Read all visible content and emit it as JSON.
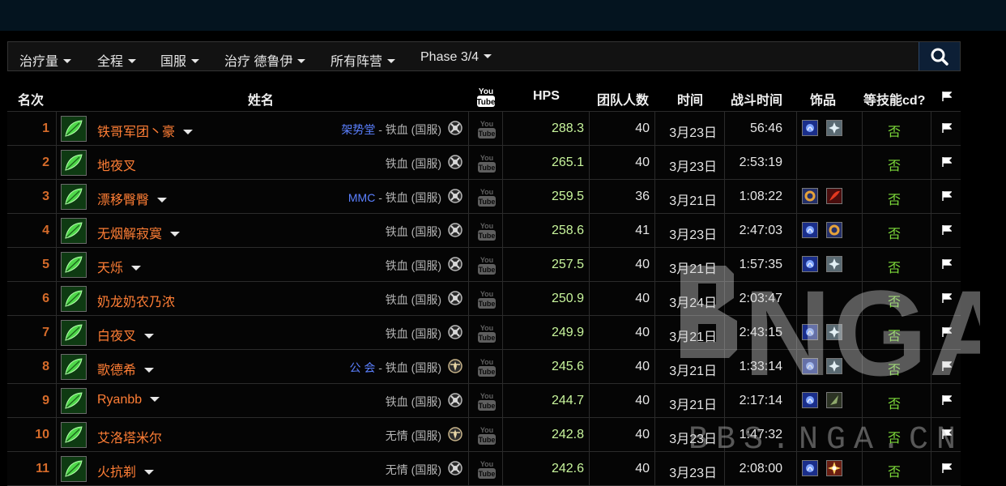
{
  "filters": [
    {
      "label": "治疗量"
    },
    {
      "label": "全程"
    },
    {
      "label": "国服"
    },
    {
      "label": "治疗 德鲁伊"
    },
    {
      "label": "所有阵营"
    },
    {
      "label": "Phase 3/4"
    }
  ],
  "columns": {
    "rank": "名次",
    "name": "姓名",
    "hps": "HPS",
    "raid_size": "团队人数",
    "date": "时间",
    "duration": "战斗时间",
    "trinkets": "饰品",
    "wait_cd": "等技能cd?"
  },
  "rows": [
    {
      "rank": "1",
      "name": "铁哥军团丶豪",
      "menu": true,
      "guild": "架势堂",
      "separator": " - ",
      "realm": "铁血 (国服)",
      "hps": "288.3",
      "raid": "40",
      "date": "3月23日",
      "dur": "56:46",
      "trinkets": [
        "blue-orb",
        "silver-star"
      ],
      "cd": "否",
      "faction": "horde"
    },
    {
      "rank": "2",
      "name": "地夜叉",
      "menu": false,
      "guild": "",
      "separator": "",
      "realm": "铁血 (国服)",
      "hps": "265.1",
      "raid": "40",
      "date": "3月23日",
      "dur": "2:53:19",
      "trinkets": [],
      "cd": "否",
      "faction": "horde"
    },
    {
      "rank": "3",
      "name": "漂移臀臀",
      "menu": true,
      "guild": "MMC",
      "separator": " - ",
      "realm": "铁血 (国服)",
      "hps": "259.5",
      "raid": "36",
      "date": "3月21日",
      "dur": "1:08:22",
      "trinkets": [
        "gold-ring",
        "red-feather"
      ],
      "cd": "否",
      "faction": "horde"
    },
    {
      "rank": "4",
      "name": "无烟解寂寞",
      "menu": true,
      "guild": "",
      "separator": "",
      "realm": "铁血 (国服)",
      "hps": "258.6",
      "raid": "41",
      "date": "3月23日",
      "dur": "2:47:03",
      "trinkets": [
        "blue-orb",
        "gold-ring"
      ],
      "cd": "否",
      "faction": "horde"
    },
    {
      "rank": "5",
      "name": "天烁",
      "menu": true,
      "guild": "",
      "separator": "",
      "realm": "铁血 (国服)",
      "hps": "257.5",
      "raid": "40",
      "date": "3月21日",
      "dur": "1:57:35",
      "trinkets": [
        "blue-orb",
        "silver-star"
      ],
      "cd": "否",
      "faction": "horde"
    },
    {
      "rank": "6",
      "name": "奶龙奶农乃浓",
      "menu": false,
      "guild": "",
      "separator": "",
      "realm": "铁血 (国服)",
      "hps": "250.9",
      "raid": "40",
      "date": "3月24日",
      "dur": "2:03:47",
      "trinkets": [],
      "cd": "否",
      "faction": "horde"
    },
    {
      "rank": "7",
      "name": "白夜叉",
      "menu": true,
      "guild": "",
      "separator": "",
      "realm": "铁血 (国服)",
      "hps": "249.9",
      "raid": "40",
      "date": "3月21日",
      "dur": "2:43:15",
      "trinkets": [
        "blue-orb",
        "silver-star"
      ],
      "cd": "否",
      "faction": "horde"
    },
    {
      "rank": "8",
      "name": "歌德希",
      "menu": true,
      "guild": "公 会",
      "separator": " - ",
      "realm": "铁血 (国服)",
      "hps": "245.6",
      "raid": "40",
      "date": "3月21日",
      "dur": "1:33:14",
      "trinkets": [
        "blue-orb",
        "silver-star"
      ],
      "cd": "否",
      "faction": "alliance"
    },
    {
      "rank": "9",
      "name": "Ryanbb",
      "menu": true,
      "guild": "",
      "separator": "",
      "realm": "铁血 (国服)",
      "hps": "244.7",
      "raid": "40",
      "date": "3月21日",
      "dur": "2:17:14",
      "trinkets": [
        "blue-orb",
        "green-shard"
      ],
      "cd": "否",
      "faction": "horde"
    },
    {
      "rank": "10",
      "name": "艾洛塔米尔",
      "menu": false,
      "guild": "",
      "separator": "",
      "realm": "无情 (国服)",
      "hps": "242.8",
      "raid": "40",
      "date": "3月23日",
      "dur": "1:47:32",
      "trinkets": [],
      "cd": "否",
      "faction": "alliance"
    },
    {
      "rank": "11",
      "name": "火抗剃",
      "menu": true,
      "guild": "",
      "separator": "",
      "realm": "无情 (国服)",
      "hps": "242.6",
      "raid": "40",
      "date": "3月23日",
      "dur": "2:08:00",
      "trinkets": [
        "blue-orb",
        "fire-burst"
      ],
      "cd": "否",
      "faction": "horde"
    }
  ],
  "watermark": {
    "logo": "NGA",
    "domain": "BBS.NGA.CN"
  },
  "colors": {
    "rank": "#d56b2a",
    "name": "#ff7e35",
    "guild": "#5b80ff",
    "hps": "#c8f59c",
    "cd": "#7ddb3a",
    "topbar": "#04141f"
  }
}
